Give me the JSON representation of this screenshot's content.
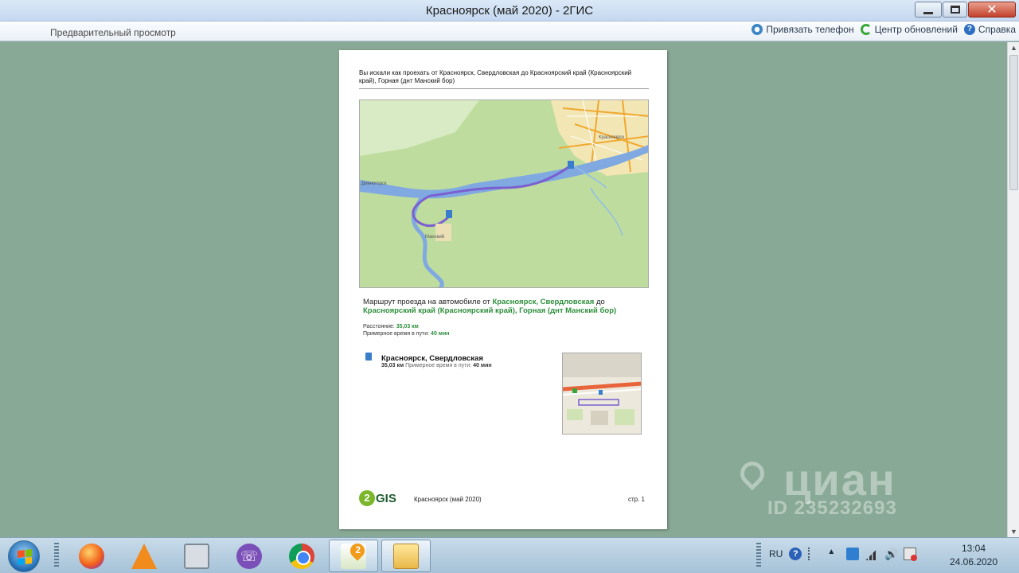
{
  "window": {
    "title": "Красноярск (май 2020) - 2ГИС",
    "close_glyph": "✕"
  },
  "toolbar": {
    "preview_label": "Предварительный просмотр",
    "bind_phone": "Привязать телефон",
    "update_center": "Центр обновлений",
    "help": "Справка"
  },
  "page": {
    "search_text": "Вы искали как проехать от Красноярск, Свердловская до Красноярский край (Красноярский край), Горная (днт Манский бор)",
    "route_prefix": "Маршрут проезда на автомобиле от ",
    "route_from": "Красноярск, Свердловская",
    "route_mid": " до ",
    "route_to": "Красноярский край (Красноярский край), Горная (днт Манский бор)",
    "distance_label": "Расстояние: ",
    "distance_value": "35,03 км",
    "time_label": "Примерное время в пути: ",
    "time_value": "40 мин",
    "step_title": "Красноярск, Свердловская",
    "step_distance": "35,03 км",
    "step_time_label": " Примерное время в пути: ",
    "step_time_value": "40 мин",
    "logo_badge": "2",
    "logo_text": "GIS",
    "footer_city": "Красноярск (май 2020)",
    "footer_page": "стр. 1"
  },
  "map": {
    "labels": [
      "Красноярск",
      "Дивногорск",
      "Манский"
    ],
    "colors": {
      "forest": "#b9d99a",
      "river": "#7fa9e0",
      "route": "#7b5fd0",
      "city": "#f3e3a8",
      "road": "#f0a830"
    }
  },
  "watermark": {
    "brand": "циан",
    "id": "ID 235232693"
  },
  "taskbar": {
    "apps": [
      "firefox-icon",
      "vlc-icon",
      "calculator-icon",
      "viber-icon",
      "chrome-icon",
      "2gis-icon",
      "explorer-icon"
    ],
    "gis_badge": "2",
    "language": "RU",
    "help_glyph": "?",
    "time": "13:04",
    "date": "24.06.2020"
  }
}
